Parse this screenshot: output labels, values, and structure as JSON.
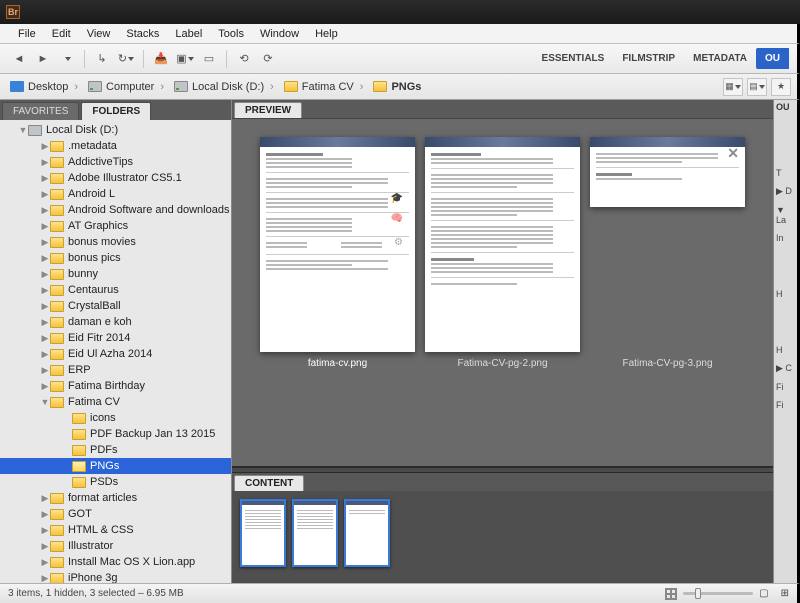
{
  "app": {
    "icon_letters": "Br",
    "title": "PNGs"
  },
  "menu": [
    "File",
    "Edit",
    "View",
    "Stacks",
    "Label",
    "Tools",
    "Window",
    "Help"
  ],
  "workspaces": {
    "items": [
      "ESSENTIALS",
      "FILMSTRIP",
      "METADATA",
      "OU"
    ],
    "active_index": 3
  },
  "breadcrumbs": [
    {
      "icon": "desktop",
      "label": "Desktop"
    },
    {
      "icon": "drive",
      "label": "Computer"
    },
    {
      "icon": "drive",
      "label": "Local Disk (D:)"
    },
    {
      "icon": "folder",
      "label": "Fatima CV"
    },
    {
      "icon": "folder",
      "label": "PNGs"
    }
  ],
  "left_panel": {
    "tabs": [
      "FAVORITES",
      "FOLDERS"
    ],
    "active_tab": 1,
    "tree": [
      {
        "depth": 1,
        "exp": "▼",
        "icon": "drive",
        "label": "Local Disk (D:)"
      },
      {
        "depth": 2,
        "exp": "▶",
        "icon": "folder",
        "label": ".metadata"
      },
      {
        "depth": 2,
        "exp": "▶",
        "icon": "folder",
        "label": "AddictiveTips"
      },
      {
        "depth": 2,
        "exp": "▶",
        "icon": "folder",
        "label": "Adobe Illustrator CS5.1"
      },
      {
        "depth": 2,
        "exp": "▶",
        "icon": "folder",
        "label": "Android L"
      },
      {
        "depth": 2,
        "exp": "▶",
        "icon": "folder",
        "label": "Android Software and downloads"
      },
      {
        "depth": 2,
        "exp": "▶",
        "icon": "folder",
        "label": "AT Graphics"
      },
      {
        "depth": 2,
        "exp": "▶",
        "icon": "folder",
        "label": "bonus movies"
      },
      {
        "depth": 2,
        "exp": "▶",
        "icon": "folder",
        "label": "bonus pics"
      },
      {
        "depth": 2,
        "exp": "▶",
        "icon": "folder",
        "label": "bunny"
      },
      {
        "depth": 2,
        "exp": "▶",
        "icon": "folder",
        "label": "Centaurus"
      },
      {
        "depth": 2,
        "exp": "▶",
        "icon": "folder",
        "label": "CrystalBall"
      },
      {
        "depth": 2,
        "exp": "▶",
        "icon": "folder",
        "label": "daman e koh"
      },
      {
        "depth": 2,
        "exp": "▶",
        "icon": "folder",
        "label": "Eid Fitr 2014"
      },
      {
        "depth": 2,
        "exp": "▶",
        "icon": "folder",
        "label": "Eid Ul Azha 2014"
      },
      {
        "depth": 2,
        "exp": "▶",
        "icon": "folder",
        "label": "ERP"
      },
      {
        "depth": 2,
        "exp": "▶",
        "icon": "folder",
        "label": "Fatima Birthday"
      },
      {
        "depth": 2,
        "exp": "▼",
        "icon": "folder",
        "label": "Fatima CV"
      },
      {
        "depth": 3,
        "exp": "",
        "icon": "folder",
        "label": "icons"
      },
      {
        "depth": 3,
        "exp": "",
        "icon": "folder",
        "label": "PDF Backup Jan 13 2015"
      },
      {
        "depth": 3,
        "exp": "",
        "icon": "folder",
        "label": "PDFs"
      },
      {
        "depth": 3,
        "exp": "",
        "icon": "folder",
        "label": "PNGs",
        "selected": true
      },
      {
        "depth": 3,
        "exp": "",
        "icon": "folder",
        "label": "PSDs"
      },
      {
        "depth": 2,
        "exp": "▶",
        "icon": "folder",
        "label": "format articles"
      },
      {
        "depth": 2,
        "exp": "▶",
        "icon": "folder",
        "label": "GOT"
      },
      {
        "depth": 2,
        "exp": "▶",
        "icon": "folder",
        "label": "HTML & CSS"
      },
      {
        "depth": 2,
        "exp": "▶",
        "icon": "folder",
        "label": "Illustrator"
      },
      {
        "depth": 2,
        "exp": "▶",
        "icon": "folder",
        "label": "Install Mac OS X Lion.app"
      },
      {
        "depth": 2,
        "exp": "▶",
        "icon": "folder",
        "label": "iPhone 3g"
      }
    ]
  },
  "preview": {
    "tab_label": "PREVIEW",
    "items": [
      {
        "caption": "fatima-cv.png",
        "selected": true,
        "height": "tall"
      },
      {
        "caption": "Fatima-CV-pg-2.png",
        "selected": false,
        "height": "tall"
      },
      {
        "caption": "Fatima-CV-pg-3.png",
        "selected": false,
        "height": "short"
      }
    ]
  },
  "content": {
    "tab_label": "CONTENT",
    "count": 3
  },
  "right_panel": {
    "header": "OU",
    "rows": [
      "T",
      "▶ D",
      "▼ La",
      "In",
      "H",
      "H",
      "▶ C",
      "Fi",
      "Fi"
    ]
  },
  "status": {
    "text": "3 items, 1 hidden, 3 selected – 6.95 MB"
  }
}
